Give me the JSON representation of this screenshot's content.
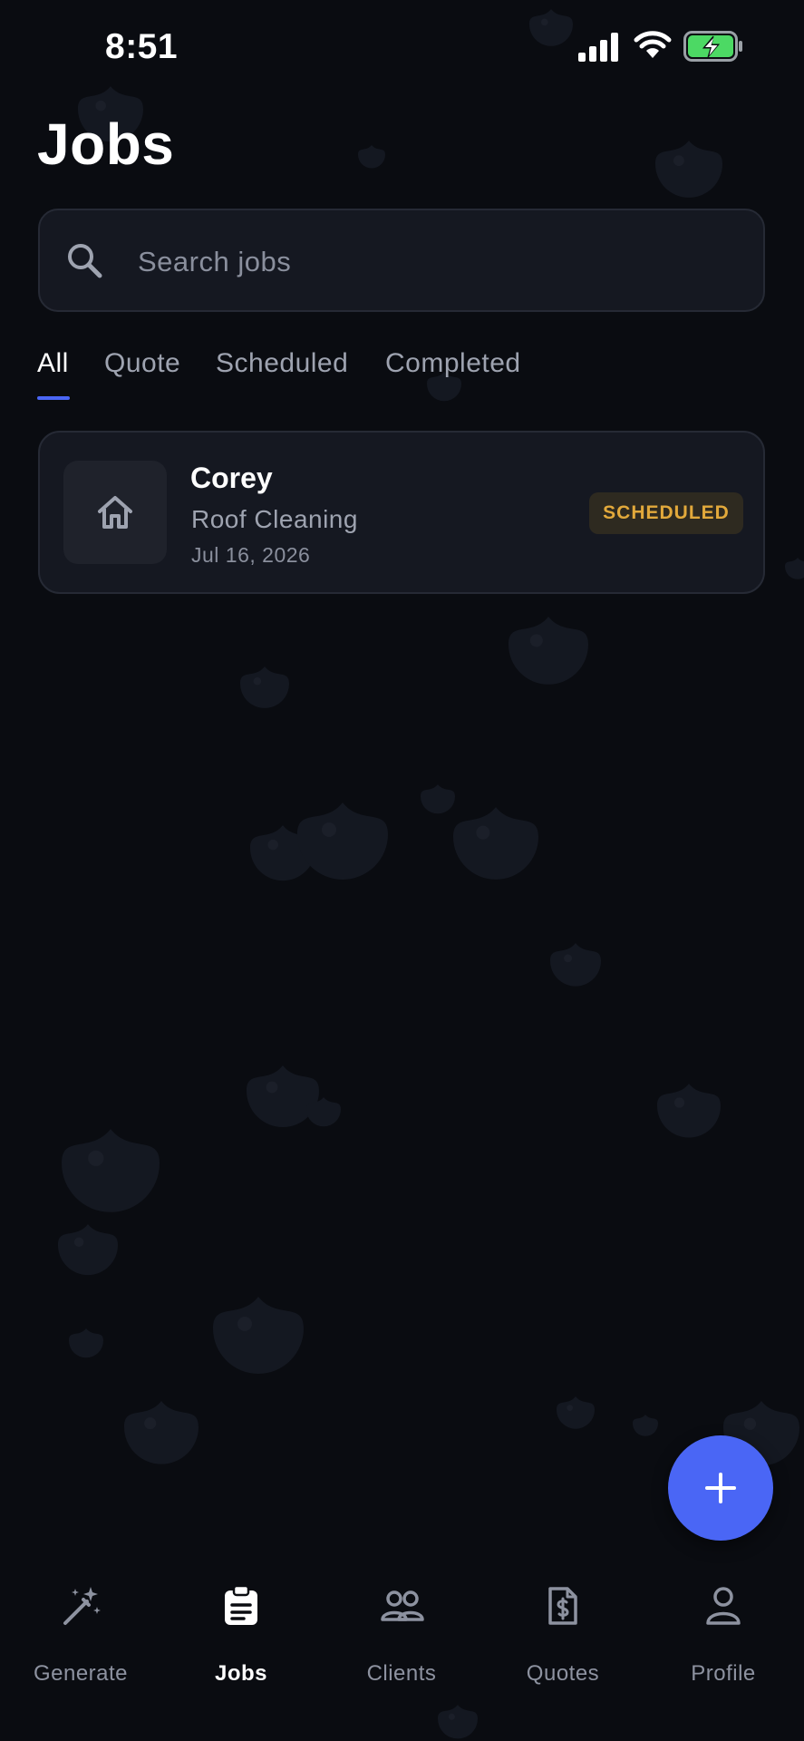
{
  "status_bar": {
    "time": "8:51",
    "icons": [
      "signal-icon",
      "wifi-icon",
      "battery-charging-icon"
    ]
  },
  "header": {
    "title": "Jobs"
  },
  "search": {
    "placeholder": "Search jobs",
    "value": ""
  },
  "tabs": [
    {
      "label": "All",
      "active": true
    },
    {
      "label": "Quote",
      "active": false
    },
    {
      "label": "Scheduled",
      "active": false
    },
    {
      "label": "Completed",
      "active": false
    }
  ],
  "jobs": [
    {
      "client": "Corey",
      "service": "Roof Cleaning",
      "date": "Jul 16, 2026",
      "status": "SCHEDULED",
      "icon": "house-icon"
    }
  ],
  "fab": {
    "icon": "plus-icon"
  },
  "bottom_nav": [
    {
      "label": "Generate",
      "icon": "magic-wand-icon",
      "active": false
    },
    {
      "label": "Jobs",
      "icon": "clipboard-icon",
      "active": true
    },
    {
      "label": "Clients",
      "icon": "people-icon",
      "active": false
    },
    {
      "label": "Quotes",
      "icon": "dollar-document-icon",
      "active": false
    },
    {
      "label": "Profile",
      "icon": "person-icon",
      "active": false
    }
  ],
  "colors": {
    "background": "#0a0c11",
    "surface": "#151821",
    "accent": "#4a66f5",
    "status_scheduled": "#e2a93b",
    "battery": "#4cd964"
  }
}
